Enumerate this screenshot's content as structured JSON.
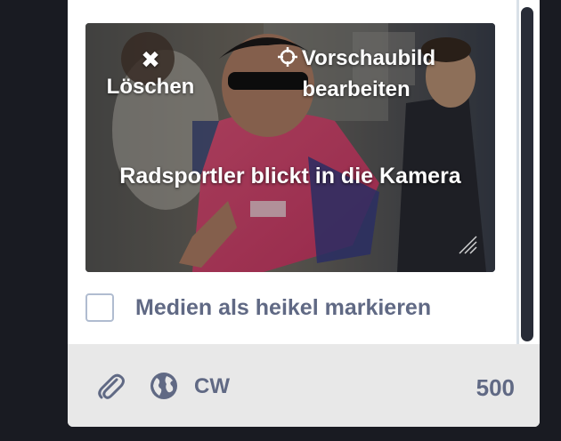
{
  "media": {
    "delete_icon": "close-icon",
    "delete_label": "Löschen",
    "edit_icon": "crosshairs-icon",
    "edit_label_line1": "Vorschaubild",
    "edit_label_line2": "bearbeiten",
    "description": "Radsportler blickt in die Kamera"
  },
  "sensitive": {
    "label": "Medien als heikel markieren",
    "checked": false
  },
  "footer": {
    "attach_icon": "paperclip-icon",
    "privacy_icon": "globe-icon",
    "cw_label": "CW",
    "char_count": "500"
  },
  "colors": {
    "page_background": "#191b22",
    "panel_background": "#ffffff",
    "footer_background": "#e8e8e8",
    "muted_text": "#606984",
    "scrollbar_thumb": "#282c37"
  }
}
